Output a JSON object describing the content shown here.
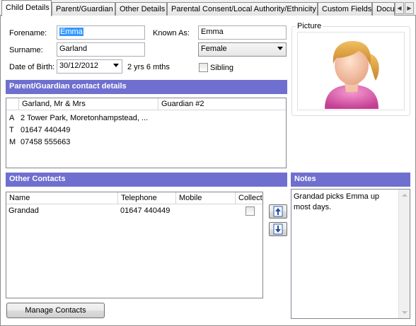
{
  "tabs": [
    {
      "label": "Child Details",
      "active": true
    },
    {
      "label": "Parent/Guardian"
    },
    {
      "label": "Other Details"
    },
    {
      "label": "Parental Consent/Local Authority/Ethnicity"
    },
    {
      "label": "Custom Fields"
    },
    {
      "label": "Docu"
    }
  ],
  "child": {
    "forename_label": "Forename:",
    "forename_value": "Emma",
    "surname_label": "Surname:",
    "surname_value": "Garland",
    "dob_label": "Date of Birth:",
    "dob_value": "30/12/2012",
    "age_text": "2 yrs 6 mths",
    "known_as_label": "Known As:",
    "known_as_value": "Emma",
    "gender_value": "Female",
    "sibling_label": "Sibling",
    "sibling_checked": false
  },
  "picture": {
    "label": "Picture",
    "icon": "child-avatar-icon"
  },
  "parent_contacts": {
    "header": "Parent/Guardian contact details",
    "columns": [
      "Garland, Mr & Mrs",
      "Guardian #2"
    ],
    "rows": [
      {
        "code": "A",
        "value": "2 Tower Park, Moretonhampstead, ..."
      },
      {
        "code": "T",
        "value": "01647 440449"
      },
      {
        "code": "M",
        "value": "07458 555663"
      }
    ]
  },
  "other_contacts": {
    "header": "Other Contacts",
    "columns": [
      "Name",
      "Telephone",
      "Mobile",
      "Collect"
    ],
    "rows": [
      {
        "name": "Grandad",
        "telephone": "01647 440449",
        "mobile": "",
        "collect": false
      }
    ],
    "manage_button": "Manage Contacts",
    "move_up_icon": "arrow-up-icon",
    "move_down_icon": "arrow-down-icon"
  },
  "notes": {
    "header": "Notes",
    "text": "Grandad picks Emma up most days."
  },
  "colors": {
    "section_header": "#6f6fcf",
    "selection": "#3399ff"
  }
}
